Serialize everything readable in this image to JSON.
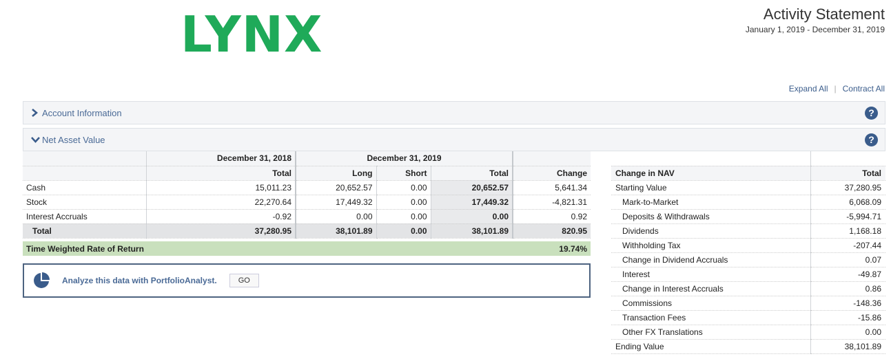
{
  "header": {
    "logo": "LYNX",
    "title": "Activity Statement",
    "period": "January 1, 2019 - December 31, 2019",
    "expand_all": "Expand All",
    "contract_all": "Contract All"
  },
  "sections": {
    "account_info": "Account Information",
    "nav": "Net Asset Value",
    "help": "?"
  },
  "nav_table": {
    "period1": "December 31, 2018",
    "period2": "December 31, 2019",
    "columns": [
      "Total",
      "Long",
      "Short",
      "Total",
      "Change"
    ],
    "rows": [
      {
        "label": "Cash",
        "prior_total": "15,011.23",
        "long": "20,652.57",
        "short": "0.00",
        "total": "20,652.57",
        "change": "5,641.34"
      },
      {
        "label": "Stock",
        "prior_total": "22,270.64",
        "long": "17,449.32",
        "short": "0.00",
        "total": "17,449.32",
        "change": "-4,821.31"
      },
      {
        "label": "Interest Accruals",
        "prior_total": "-0.92",
        "long": "0.00",
        "short": "0.00",
        "total": "0.00",
        "change": "0.92"
      }
    ],
    "total_row": {
      "label": "Total",
      "prior_total": "37,280.95",
      "long": "38,101.89",
      "short": "0.00",
      "total": "38,101.89",
      "change": "820.95"
    },
    "twr_label": "Time Weighted Rate of Return",
    "twr_value": "19.74%"
  },
  "portfolio_analyst": {
    "text": "Analyze this data with PortfolioAnalyst.",
    "button": "GO"
  },
  "change_table": {
    "header_label": "Change in NAV",
    "header_total": "Total",
    "rows": [
      {
        "label": "Starting Value",
        "value": "37,280.95"
      },
      {
        "label": "Mark-to-Market",
        "value": "6,068.09"
      },
      {
        "label": "Deposits & Withdrawals",
        "value": "-5,994.71"
      },
      {
        "label": "Dividends",
        "value": "1,168.18"
      },
      {
        "label": "Withholding Tax",
        "value": "-207.44"
      },
      {
        "label": "Change in Dividend Accruals",
        "value": "0.07"
      },
      {
        "label": "Interest",
        "value": "-49.87"
      },
      {
        "label": "Change in Interest Accruals",
        "value": "0.86"
      },
      {
        "label": "Commissions",
        "value": "-148.36"
      },
      {
        "label": "Transaction Fees",
        "value": "-15.86"
      },
      {
        "label": "Other FX Translations",
        "value": "0.00"
      },
      {
        "label": "Ending Value",
        "value": "38,101.89"
      }
    ]
  },
  "colors": {
    "brand_green": "#1faa59",
    "link_blue": "#3a5c8b",
    "twr_green": "#c9e0bd"
  },
  "icons": [
    "chevron-right-icon",
    "chevron-down-icon",
    "help-icon",
    "pie-chart-icon"
  ]
}
